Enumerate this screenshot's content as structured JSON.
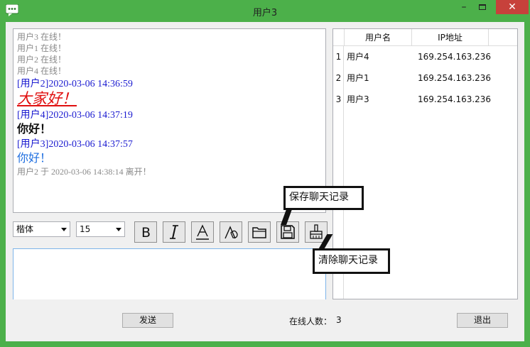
{
  "window": {
    "title": "用户3"
  },
  "chat": {
    "messages": [
      {
        "kind": "gray",
        "text": "用户3 在线！"
      },
      {
        "kind": "gray",
        "text": "用户1 在线！"
      },
      {
        "kind": "gray",
        "text": "用户2 在线！"
      },
      {
        "kind": "gray",
        "text": "用户4 在线！"
      },
      {
        "kind": "head",
        "text": "[用户2]2020-03-06 14:36:59"
      },
      {
        "kind": "big-red",
        "text": "大家好！"
      },
      {
        "kind": "head",
        "text": "[用户4]2020-03-06 14:37:19"
      },
      {
        "kind": "bold",
        "text": "你好！"
      },
      {
        "kind": "head",
        "text": "[用户3]2020-03-06 14:37:57"
      },
      {
        "kind": "blue",
        "text": "你好！"
      },
      {
        "kind": "gray",
        "text": "用户2 于 2020-03-06 14:38:14 离开！"
      }
    ]
  },
  "toolbar": {
    "font_value": "楷体",
    "size_value": "15"
  },
  "users": {
    "headers": [
      "用户名",
      "IP地址"
    ],
    "rows": [
      {
        "index": "1",
        "name": "用户4",
        "ip": "169.254.163.236"
      },
      {
        "index": "2",
        "name": "用户1",
        "ip": "169.254.163.236"
      },
      {
        "index": "3",
        "name": "用户3",
        "ip": "169.254.163.236"
      }
    ]
  },
  "bottom": {
    "send_label": "发送",
    "online_label": "在线人数：",
    "online_count": "3",
    "exit_label": "退出"
  },
  "callouts": {
    "save": "保存聊天记录",
    "clear": "清除聊天记录"
  },
  "colors": {
    "frame": "#4cb04a",
    "close": "#c7413b",
    "timestamp": "#1b1bd0",
    "red": "#e01010",
    "blue": "#1f6fe0"
  }
}
